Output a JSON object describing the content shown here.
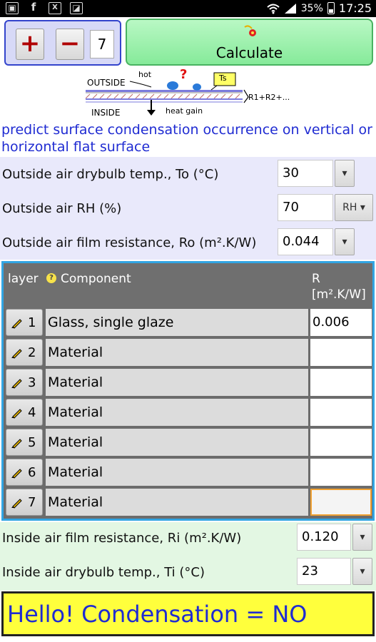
{
  "status_bar": {
    "battery_percent": "35%",
    "time": "17:25",
    "icons": [
      "image-icon",
      "facebook-icon",
      "excel-icon",
      "photo-icon",
      "wifi-icon",
      "signal-icon",
      "battery-icon"
    ]
  },
  "toolbar": {
    "plus_label": "+",
    "minus_label": "−",
    "layer_count": "7",
    "calculate_label": "Calculate"
  },
  "diagram": {
    "outside": "OUTSIDE",
    "inside": "INSIDE",
    "hot": "hot",
    "question": "?",
    "ts": "Ts",
    "heat_gain": "heat gain",
    "formula": "R1+R2+..."
  },
  "description": "predict surface condensation occurrence on vertical or horizontal flat surface",
  "outside_inputs": {
    "drybulb_label": "Outside air drybulb temp., To (°C)",
    "drybulb_value": "30",
    "rh_label": "Outside air RH (%)",
    "rh_value": "70",
    "rh_unit": "RH",
    "film_label": "Outside air film resistance, Ro (m².K/W)",
    "film_value": "0.044"
  },
  "table": {
    "col_layer": "layer",
    "col_component": "Component",
    "col_r_line1": "R",
    "col_r_line2": "[m².K/W]",
    "rows": [
      {
        "num": "1",
        "component": "Glass, single glaze",
        "r": "0.006"
      },
      {
        "num": "2",
        "component": "Material",
        "r": ""
      },
      {
        "num": "3",
        "component": "Material",
        "r": ""
      },
      {
        "num": "4",
        "component": "Material",
        "r": ""
      },
      {
        "num": "5",
        "component": "Material",
        "r": ""
      },
      {
        "num": "6",
        "component": "Material",
        "r": ""
      },
      {
        "num": "7",
        "component": "Material",
        "r": ""
      }
    ]
  },
  "inside_inputs": {
    "film_label": "Inside air film resistance, Ri (m².K/W)",
    "film_value": "0.120",
    "drybulb_label": "Inside air drybulb temp., Ti (°C)",
    "drybulb_value": "23"
  },
  "result": "Hello! Condensation = NO",
  "colors": {
    "accent_blue": "#1f2bd2",
    "result_bg": "#ffff3c",
    "calc_green": "#86ea9a",
    "table_border": "#31a5e3"
  }
}
